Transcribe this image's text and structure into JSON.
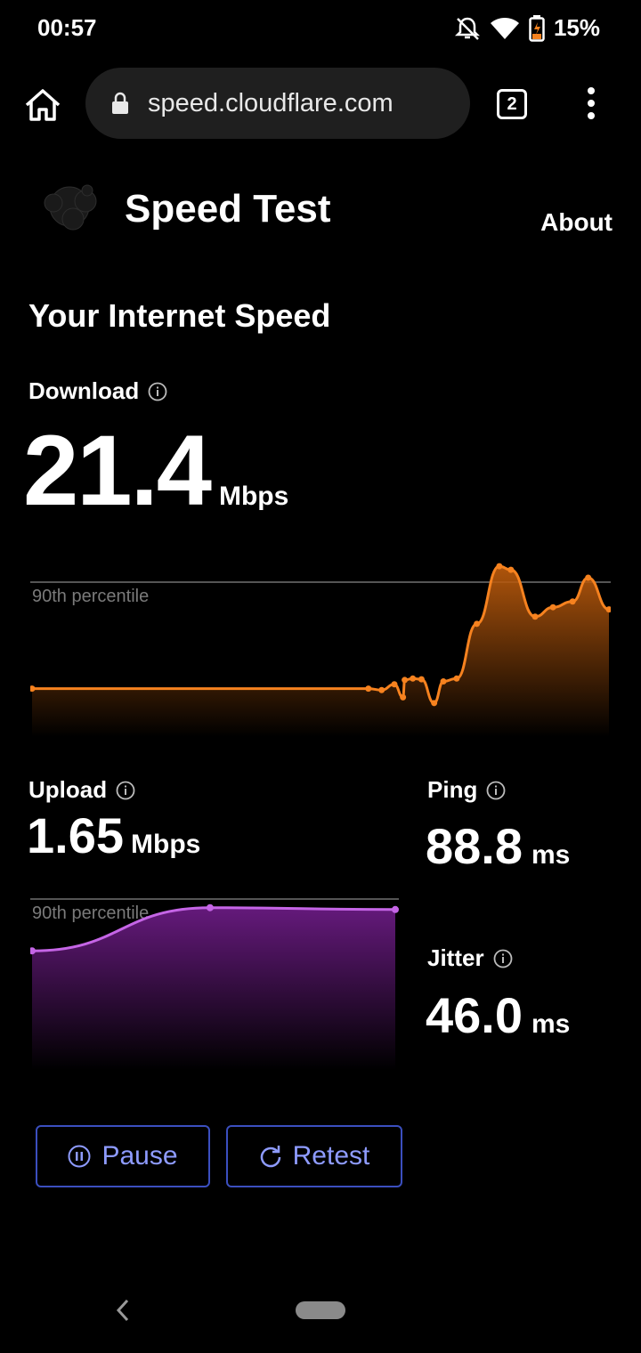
{
  "status_bar": {
    "time": "00:57",
    "battery": "15%"
  },
  "browser": {
    "url": "speed.cloudflare.com",
    "tab_count": "2"
  },
  "header": {
    "title": "Speed Test",
    "about": "About"
  },
  "section_title": "Your Internet Speed",
  "download": {
    "label": "Download",
    "value": "21.4",
    "unit": "Mbps",
    "percentile_label": "90th percentile",
    "chart_data": {
      "type": "area",
      "series": [
        {
          "values": [
            4.0,
            4.0,
            3.8,
            4.6,
            2.8,
            5.2,
            5.4,
            5.3,
            2.0,
            5.0,
            5.4,
            13.0,
            21.0,
            20.5,
            14.0,
            15.3,
            16.1,
            19.4,
            15.0
          ]
        }
      ],
      "ylim": [
        0,
        22
      ]
    }
  },
  "upload": {
    "label": "Upload",
    "value": "1.65",
    "unit": "Mbps",
    "percentile_label": "90th percentile",
    "chart_data": {
      "type": "area",
      "series": [
        {
          "values": [
            1.2,
            1.67,
            1.65
          ]
        }
      ],
      "ylim": [
        0,
        1.9
      ]
    }
  },
  "ping": {
    "label": "Ping",
    "value": "88.8",
    "unit": "ms"
  },
  "jitter": {
    "label": "Jitter",
    "value": "46.0",
    "unit": "ms"
  },
  "buttons": {
    "pause": "Pause",
    "retest": "Retest"
  },
  "colors": {
    "download": "#f6821f",
    "upload": "#c565e6",
    "button_border": "#3b4fbf",
    "button_text": "#8e9bff"
  }
}
